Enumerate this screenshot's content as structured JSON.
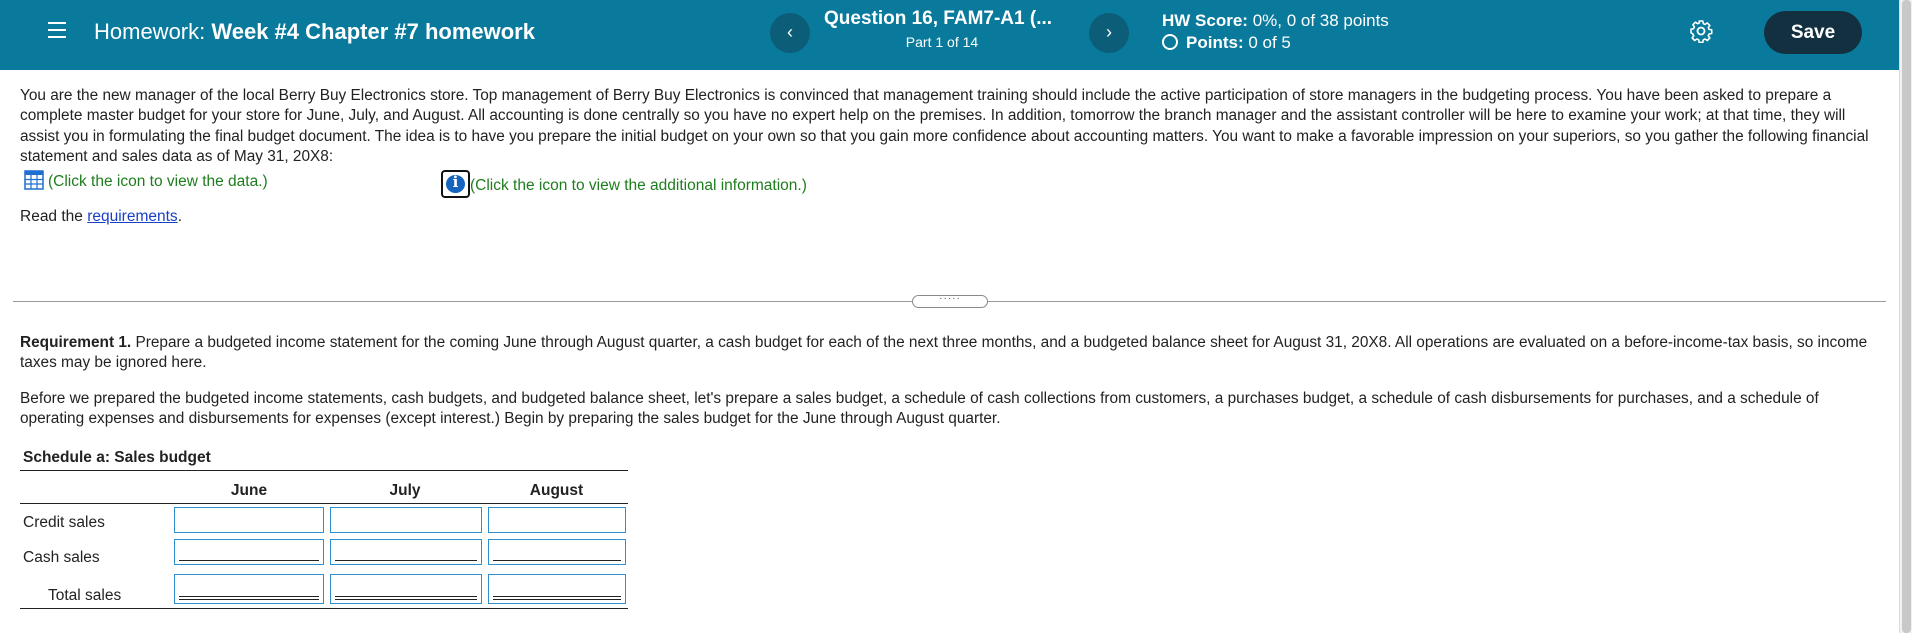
{
  "header": {
    "homework_label": "Homework:",
    "homework_name": "Week #4 Chapter #7 homework",
    "question_title": "Question 16, FAM7-A1 (...",
    "part": "Part 1 of 14",
    "hw_score_label": "HW Score:",
    "hw_score_value": "0%, 0 of 38 points",
    "points_label": "Points:",
    "points_value": "0 of 5",
    "save_label": "Save",
    "prev_icon": "‹",
    "next_icon": "›",
    "bg_color": "#0a7a9c"
  },
  "intro": {
    "text": "You are the new manager of the local Berry Buy Electronics store. Top management of Berry Buy Electronics is convinced that management training should include the active participation of store managers in the budgeting process. You have been asked to prepare a complete master budget for your store for June, July, and August. All accounting is done centrally so you have no expert help on the premises. In addition, tomorrow the branch manager and the assistant controller will be here to examine your work; at that time, they will assist you in formulating the final budget document. The idea is to have you prepare the initial budget on your own so that you gain more confidence about accounting matters. You want to make a favorable impression on your superiors, so you gather the following financial statement and sales data as of May 31, 20X8:",
    "data_link": "(Click the icon to view the data.)",
    "info_link": "(Click the icon to view the additional information.)",
    "read_prefix": "Read the ",
    "requirements_link": "requirements",
    "read_suffix": "."
  },
  "requirement": {
    "label": "Requirement 1.",
    "text": " Prepare a budgeted income statement for the coming June through August quarter, a cash budget for each of the next three months, and a budgeted balance sheet for August 31, 20X8. All operations are evaluated on a before-income-tax basis, so income taxes may be ignored here.",
    "before_text": "Before we prepared the budgeted income statements, cash budgets, and budgeted balance sheet, let's prepare a sales budget, a schedule of cash collections from customers, a purchases budget, a schedule of cash disbursements for purchases, and a schedule of operating expenses and disbursements for expenses (except interest.) Begin by preparing the sales budget for the June through August quarter."
  },
  "schedule": {
    "title": "Schedule a: Sales budget",
    "columns": [
      "June",
      "July",
      "August"
    ],
    "rows": [
      {
        "label": "Credit sales",
        "values": [
          "",
          "",
          ""
        ]
      },
      {
        "label": "Cash sales",
        "values": [
          "",
          "",
          ""
        ]
      },
      {
        "label": "Total sales",
        "values": [
          "",
          "",
          ""
        ]
      }
    ]
  }
}
